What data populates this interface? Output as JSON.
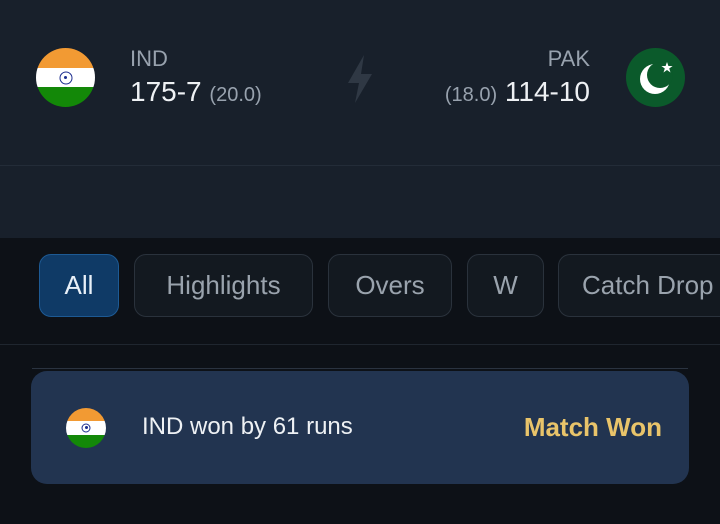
{
  "scoreboard": {
    "home": {
      "code": "IND",
      "score": "175-7",
      "overs": "(20.0)",
      "flag": "india-flag"
    },
    "away": {
      "code": "PAK",
      "score": "114-10",
      "overs": "(18.0)",
      "flag": "pakistan-flag"
    },
    "center_icon": "lightning-icon"
  },
  "filters": {
    "items": [
      {
        "label": "All",
        "active": true
      },
      {
        "label": "Highlights",
        "active": false
      },
      {
        "label": "Overs",
        "active": false
      },
      {
        "label": "W",
        "active": false
      },
      {
        "label": "Catch Drop",
        "active": false
      }
    ]
  },
  "result": {
    "flag": "india-flag",
    "text": "IND won by 61 runs",
    "status": "Match Won"
  },
  "colors": {
    "scoreboard_bg": "#18202b",
    "page_bg": "#0d1117",
    "active_chip": "#0f3a66",
    "card_bg": "#223450",
    "status_gold": "#e9c46a"
  }
}
